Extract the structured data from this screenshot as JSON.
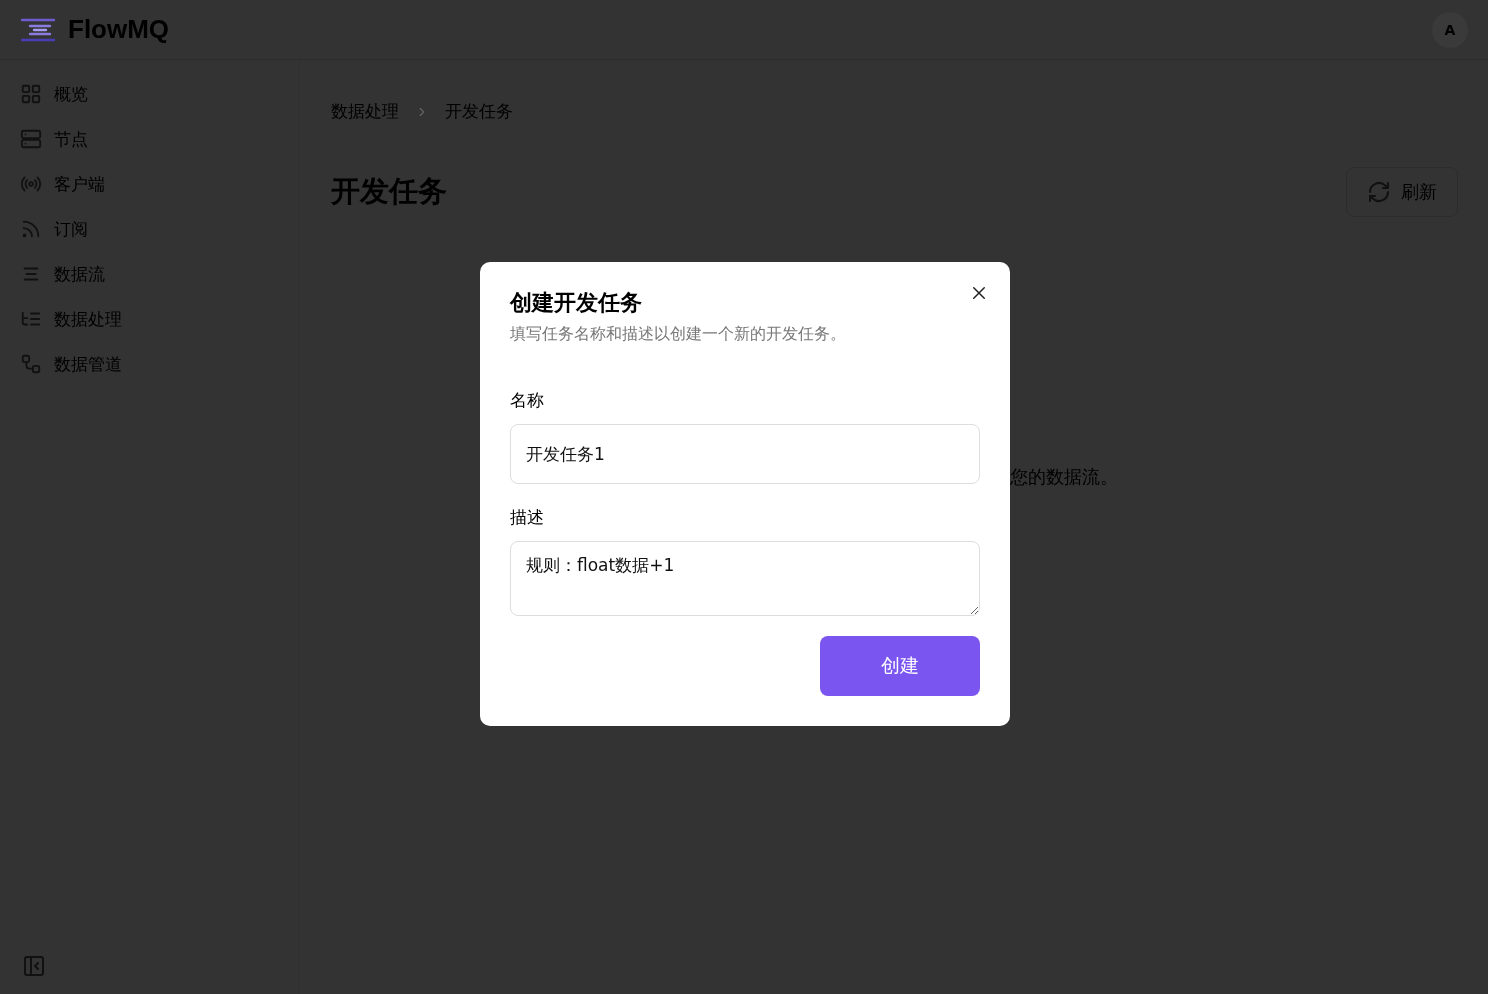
{
  "app": {
    "name": "FlowMQ",
    "avatar": "A"
  },
  "sidebar": {
    "items": [
      {
        "label": "概览"
      },
      {
        "label": "节点"
      },
      {
        "label": "客户端"
      },
      {
        "label": "订阅"
      },
      {
        "label": "数据流"
      },
      {
        "label": "数据处理"
      },
      {
        "label": "数据管道"
      }
    ]
  },
  "breadcrumb": [
    "数据处理",
    "开发任务"
  ],
  "page": {
    "title": "开发任务",
    "refresh_button": "刷新",
    "empty_text": "您的数据流。"
  },
  "dialog": {
    "title": "创建开发任务",
    "description": "填写任务名称和描述以创建一个新的开发任务。",
    "fields": [
      {
        "label": "名称",
        "kind": "input",
        "value": "开发任务1"
      },
      {
        "label": "描述",
        "kind": "textarea",
        "value": "规则：float数据+1"
      }
    ],
    "submit_button": "创建"
  }
}
